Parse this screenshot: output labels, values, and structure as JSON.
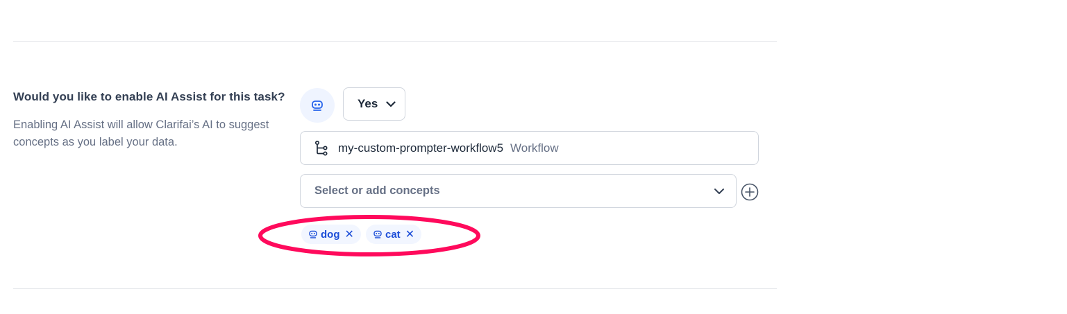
{
  "ai_assist": {
    "question": "Would you like to enable AI Assist for this task?",
    "description": "Enabling AI Assist will allow Clarifai’s AI to suggest concepts as you label your data.",
    "enabled_value": "Yes",
    "workflow": {
      "name": "my-custom-prompter-workflow5",
      "type_label": "Workflow"
    },
    "concepts": {
      "placeholder": "Select or add concepts",
      "tags": [
        {
          "label": "dog",
          "icon": "robot-icon"
        },
        {
          "label": "cat",
          "icon": "robot-icon"
        }
      ]
    }
  },
  "colors": {
    "accent": "#1d4ed8",
    "tag_background": "#f2f6ff",
    "annotation": "#ff0a5c",
    "border": "#d0d5dd"
  }
}
